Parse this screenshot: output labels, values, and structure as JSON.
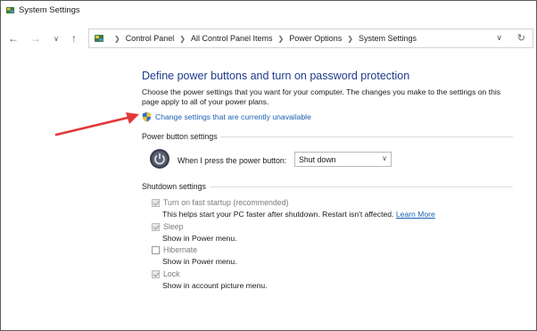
{
  "window": {
    "title": "System Settings"
  },
  "nav": {
    "back_icon": "arrow-left-icon",
    "forward_icon": "arrow-right-icon",
    "recent_icon": "chevron-down-icon",
    "up_icon": "arrow-up-icon",
    "breadcrumbs": [
      "Control Panel",
      "All Control Panel Items",
      "Power Options",
      "System Settings"
    ],
    "refresh_icon": "refresh-icon"
  },
  "content": {
    "heading": "Define power buttons and turn on password protection",
    "description": "Choose the power settings that you want for your computer. The changes you make to the settings on this page apply to all of your power plans.",
    "change_link": "Change settings that are currently unavailable",
    "power_section": {
      "title": "Power button settings",
      "label": "When I press the power button:",
      "selected": "Shut down"
    },
    "shutdown_section": {
      "title": "Shutdown settings",
      "options": [
        {
          "label": "Turn on fast startup (recommended)",
          "desc": "This helps start your PC faster after shutdown. Restart isn't affected.",
          "link": "Learn More",
          "checked": true
        },
        {
          "label": "Sleep",
          "desc": "Show in Power menu.",
          "checked": true
        },
        {
          "label": "Hibernate",
          "desc": "Show in Power menu.",
          "checked": false
        },
        {
          "label": "Lock",
          "desc": "Show in account picture menu.",
          "checked": true
        }
      ]
    }
  },
  "colors": {
    "heading": "#1f3b8a",
    "link": "#1a5fb4",
    "annotation_arrow": "#e0393b"
  }
}
